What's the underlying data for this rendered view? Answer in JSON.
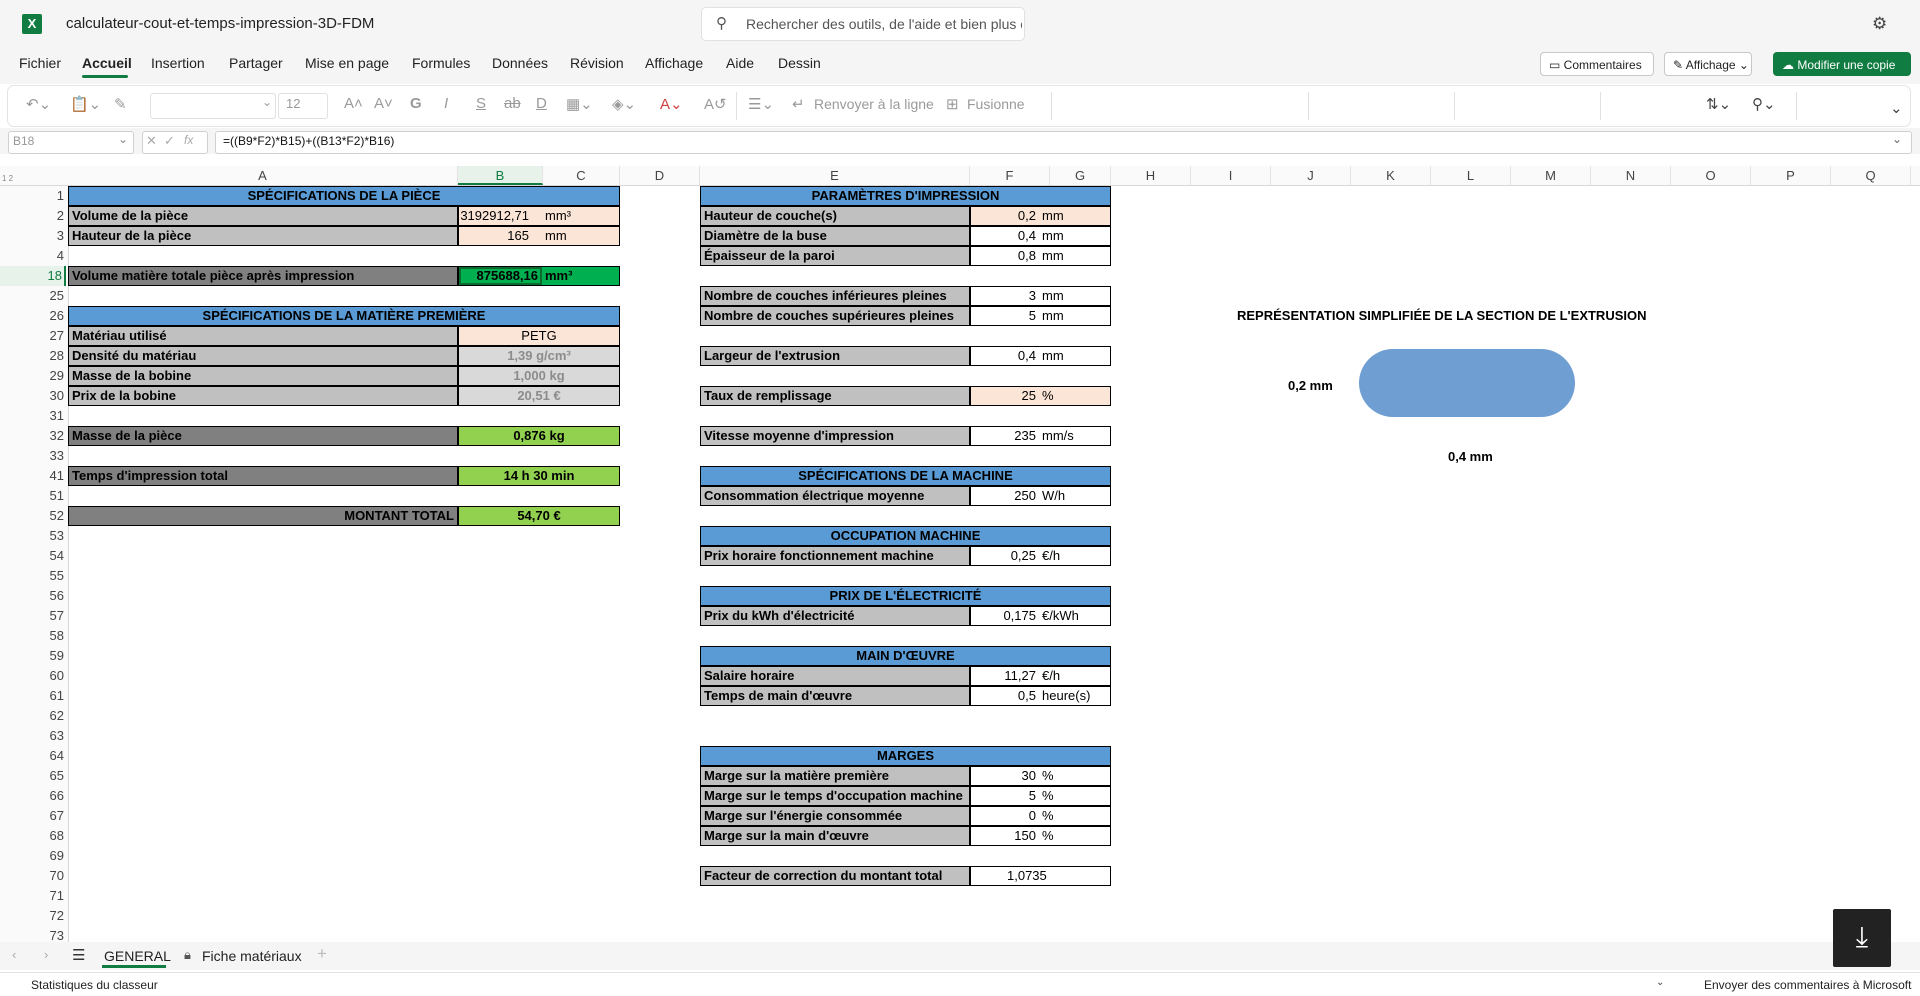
{
  "app": {
    "logo": "X",
    "doc_title": "calculateur-cout-et-temps-impression-3D-FDM",
    "search_placeholder": "Rechercher des outils, de l'aide et bien plus e",
    "settings_icon": "gear-icon"
  },
  "menu": {
    "items": [
      "Fichier",
      "Accueil",
      "Insertion",
      "Partager",
      "Mise en page",
      "Formules",
      "Données",
      "Révision",
      "Affichage",
      "Aide",
      "Dessin"
    ],
    "active": "Accueil",
    "comments_label": "Commentaires",
    "view_label": "Affichage",
    "edit_copy_label": "Modifier une copie"
  },
  "ribbon": {
    "font_size": "12",
    "wrap_label": "Renvoyer à la ligne",
    "merge_label": "Fusionne"
  },
  "formula_bar": {
    "name_box": "B18",
    "fx_label": "fx",
    "formula": "=((B9*F2)*B15)+((B13*F2)*B16)"
  },
  "columns": [
    "A",
    "B",
    "C",
    "D",
    "E",
    "F",
    "G",
    "H",
    "I",
    "J",
    "K",
    "L",
    "M",
    "N",
    "O",
    "P",
    "Q"
  ],
  "rows": [
    "1",
    "2",
    "3",
    "4",
    "18",
    "25",
    "26",
    "27",
    "28",
    "29",
    "30",
    "31",
    "32",
    "33",
    "41",
    "51",
    "52",
    "53",
    "54",
    "55",
    "56",
    "57",
    "58",
    "59",
    "60",
    "61",
    "62",
    "63",
    "64",
    "65",
    "66",
    "67",
    "68",
    "69",
    "70",
    "71",
    "72",
    "73"
  ],
  "left_table": {
    "piece_header": "SPÉCIFICATIONS DE LA PIÈCE",
    "volume_label": "Volume de la pièce",
    "volume_value": "3192912,71",
    "volume_unit": "mm³",
    "height_label": "Hauteur de la pièce",
    "height_value": "165",
    "height_unit": "mm",
    "total_volume_label": "Volume matière totale pièce après impression",
    "total_volume_value": "875688,16",
    "total_volume_unit": "mm³",
    "material_header": "SPÉCIFICATIONS DE LA MATIÈRE PREMIÈRE",
    "material_label": "Matériau utilisé",
    "material_value": "PETG",
    "density_label": "Densité du matériau",
    "density_value": "1,39 g/cm³",
    "spool_mass_label": "Masse de la bobine",
    "spool_mass_value": "1,000 kg",
    "spool_price_label": "Prix de la bobine",
    "spool_price_value": "20,51 €",
    "part_mass_label": "Masse de la pièce",
    "part_mass_value": "0,876 kg",
    "print_time_label": "Temps d'impression total",
    "print_time_value": "14 h 30 min",
    "total_label": "MONTANT TOTAL",
    "total_value": "54,70 €"
  },
  "right_table": {
    "print_header": "PARAMÈTRES D'IMPRESSION",
    "layer_label": "Hauteur de couche(s)",
    "layer_value": "0,2",
    "layer_unit": "mm",
    "nozzle_label": "Diamètre de la buse",
    "nozzle_value": "0,4",
    "nozzle_unit": "mm",
    "wall_label": "Épaisseur de la paroi",
    "wall_value": "0,8",
    "wall_unit": "mm",
    "bottom_label": "Nombre de couches inférieures pleines",
    "bottom_value": "3",
    "bottom_unit": "mm",
    "top_label": "Nombre de couches supérieures pleines",
    "top_value": "5",
    "top_unit": "mm",
    "extrusion_label": "Largeur de l'extrusion",
    "extrusion_value": "0,4",
    "extrusion_unit": "mm",
    "infill_label": "Taux de remplissage",
    "infill_value": "25",
    "infill_unit": "%",
    "speed_label": "Vitesse moyenne d'impression",
    "speed_value": "235",
    "speed_unit": "mm/s",
    "machine_header": "SPÉCIFICATIONS DE LA MACHINE",
    "power_label": "Consommation électrique moyenne",
    "power_value": "250",
    "power_unit": "W/h",
    "occupation_header": "OCCUPATION MACHINE",
    "hourly_machine_label": "Prix horaire fonctionnement machine",
    "hourly_machine_value": "0,25",
    "hourly_machine_unit": "€/h",
    "electricity_header": "PRIX DE L'ÉLECTRICITÉ",
    "kwh_label": "Prix du kWh d'électricité",
    "kwh_value": "0,175",
    "kwh_unit": "€/kWh",
    "labor_header": "MAIN D'ŒUVRE",
    "salary_label": "Salaire horaire",
    "salary_value": "11,27",
    "salary_unit": "€/h",
    "labor_time_label": "Temps de main d'œuvre",
    "labor_time_value": "0,5",
    "labor_time_unit": "heure(s)",
    "margins_header": "MARGES",
    "m1_label": "Marge sur la matière première",
    "m1_value": "30",
    "m1_unit": "%",
    "m2_label": "Marge sur le temps d'occupation machine",
    "m2_value": "5",
    "m2_unit": "%",
    "m3_label": "Marge sur l'énergie consommée",
    "m3_value": "0",
    "m3_unit": "%",
    "m4_label": "Marge sur la main d'œuvre",
    "m4_value": "150",
    "m4_unit": "%",
    "corr_label": "Facteur de correction du montant total",
    "corr_value": "1,0735"
  },
  "diagram": {
    "title": "REPRÉSENTATION SIMPLIFIÉE DE LA SECTION DE L'EXTRUSION",
    "height_label": "0,2 mm",
    "width_label": "0,4 mm",
    "fill_color": "#6f9ed2"
  },
  "sheets": {
    "active": "GENERAL",
    "second": "Fiche matériaux"
  },
  "status": {
    "left": "Statistiques du classeur",
    "right": "Envoyer des commentaires à Microsoft"
  }
}
